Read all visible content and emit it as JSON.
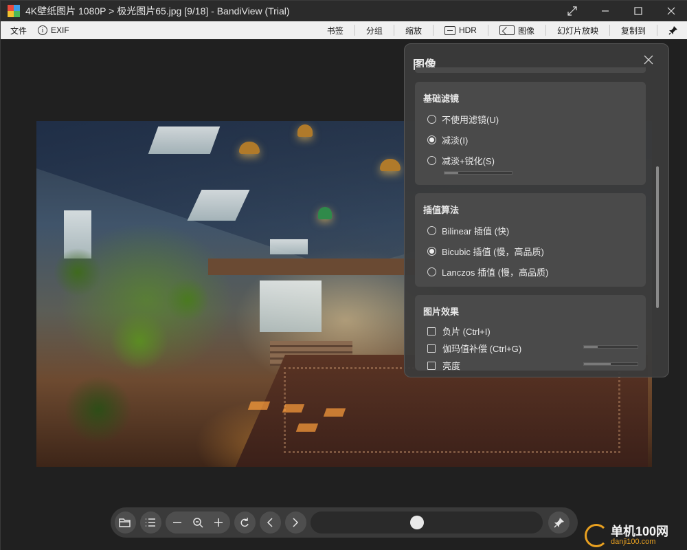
{
  "window": {
    "title": "4K壁纸图片 1080P > 极光图片65.jpg [9/18] - BandiView (Trial)",
    "logo_colors": [
      "#e84a3c",
      "#3c9de8",
      "#f2c12e",
      "#4bb85a"
    ]
  },
  "menu": {
    "left": [
      {
        "label": "文件",
        "icon": null
      },
      {
        "label": "EXIF",
        "icon": "info-icon"
      }
    ],
    "right": [
      {
        "label": "书签"
      },
      {
        "label": "分组"
      },
      {
        "label": "缩放"
      },
      {
        "label": "HDR",
        "icon": "hdr-icon"
      },
      {
        "label": "图像",
        "icon": "image-icon"
      },
      {
        "label": "幻灯片放映"
      },
      {
        "label": "复制到"
      }
    ]
  },
  "panel": {
    "title": "图像",
    "basic_filter": {
      "title": "基础滤镜",
      "options": [
        {
          "label": "不使用滤镜(U)",
          "selected": false
        },
        {
          "label": "减淡(I)",
          "selected": true
        },
        {
          "label": "减淡+锐化(S)",
          "selected": false
        }
      ],
      "sharpen_level": 0.2
    },
    "interpolation": {
      "title": "插值算法",
      "options": [
        {
          "label": "Bilinear 插值 (快)",
          "selected": false
        },
        {
          "label": "Bicubic 插值 (慢，高品质)",
          "selected": true
        },
        {
          "label": "Lanczos 插值 (慢，高品质)",
          "selected": false
        }
      ]
    },
    "effects": {
      "title": "图片效果",
      "items": [
        {
          "label": "负片 (Ctrl+I)",
          "checked": false,
          "has_slider": false
        },
        {
          "label": "伽玛值补偿 (Ctrl+G)",
          "checked": false,
          "has_slider": true,
          "level": 0.25
        },
        {
          "label": "亮度",
          "checked": false,
          "has_slider": true,
          "level": 0.5
        }
      ]
    }
  },
  "toolbar": {
    "progress": 0.44,
    "buttons": [
      "folder-icon",
      "list-icon",
      "zoom-out-icon",
      "zoom-fit-icon",
      "zoom-in-icon",
      "rotate-icon",
      "prev-icon",
      "next-icon",
      "pin-icon"
    ]
  },
  "watermark": {
    "brand": "单机100网",
    "url": "danji100.com",
    "accent": "#e8a020"
  }
}
